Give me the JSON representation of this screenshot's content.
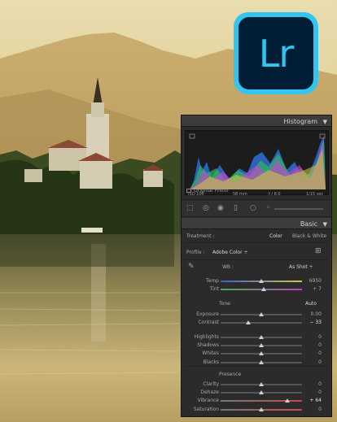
{
  "logo": {
    "text": "Lr",
    "bg": "#001e36",
    "accent": "#31c5f0"
  },
  "panel": {
    "histogram": {
      "title": "Histogram",
      "iso": "ISO 100",
      "focal": "58 mm",
      "aperture": "f / 8.0",
      "shutter": "1/15 sec",
      "original_photo": "Original Photo"
    },
    "basic": {
      "title": "Basic",
      "treatment_label": "Treatment :",
      "treatment_color": "Color",
      "treatment_bw": "Black & White",
      "profile_label": "Profile :",
      "profile_value": "Adobe Color ÷",
      "wb_label": "WB :",
      "wb_value": "As Shot ÷",
      "tone_label": "Tone",
      "auto_label": "Auto",
      "presence_label": "Presence",
      "sliders": [
        {
          "label": "Temp",
          "value": "6950",
          "level": 0.5,
          "group": "wb"
        },
        {
          "label": "Tint",
          "value": "+ 7",
          "level": 0.53,
          "group": "wb"
        },
        {
          "label": "Exposure",
          "value": "0.00",
          "level": 0.5,
          "group": "tone"
        },
        {
          "label": "Contrast",
          "value": "− 33",
          "level": 0.34,
          "group": "tone"
        },
        {
          "label": "Highlights",
          "value": "0",
          "level": 0.5,
          "group": "tone2"
        },
        {
          "label": "Shadows",
          "value": "0",
          "level": 0.5,
          "group": "tone2"
        },
        {
          "label": "Whites",
          "value": "0",
          "level": 0.5,
          "group": "tone2"
        },
        {
          "label": "Blacks",
          "value": "0",
          "level": 0.5,
          "group": "tone2"
        },
        {
          "label": "Clarity",
          "value": "0",
          "level": 0.5,
          "group": "presence"
        },
        {
          "label": "Dehaze",
          "value": "0",
          "level": 0.5,
          "group": "presence"
        },
        {
          "label": "Vibrance",
          "value": "+ 64",
          "level": 0.82,
          "group": "presence"
        },
        {
          "label": "Saturation",
          "value": "0",
          "level": 0.5,
          "group": "presence"
        }
      ]
    }
  }
}
